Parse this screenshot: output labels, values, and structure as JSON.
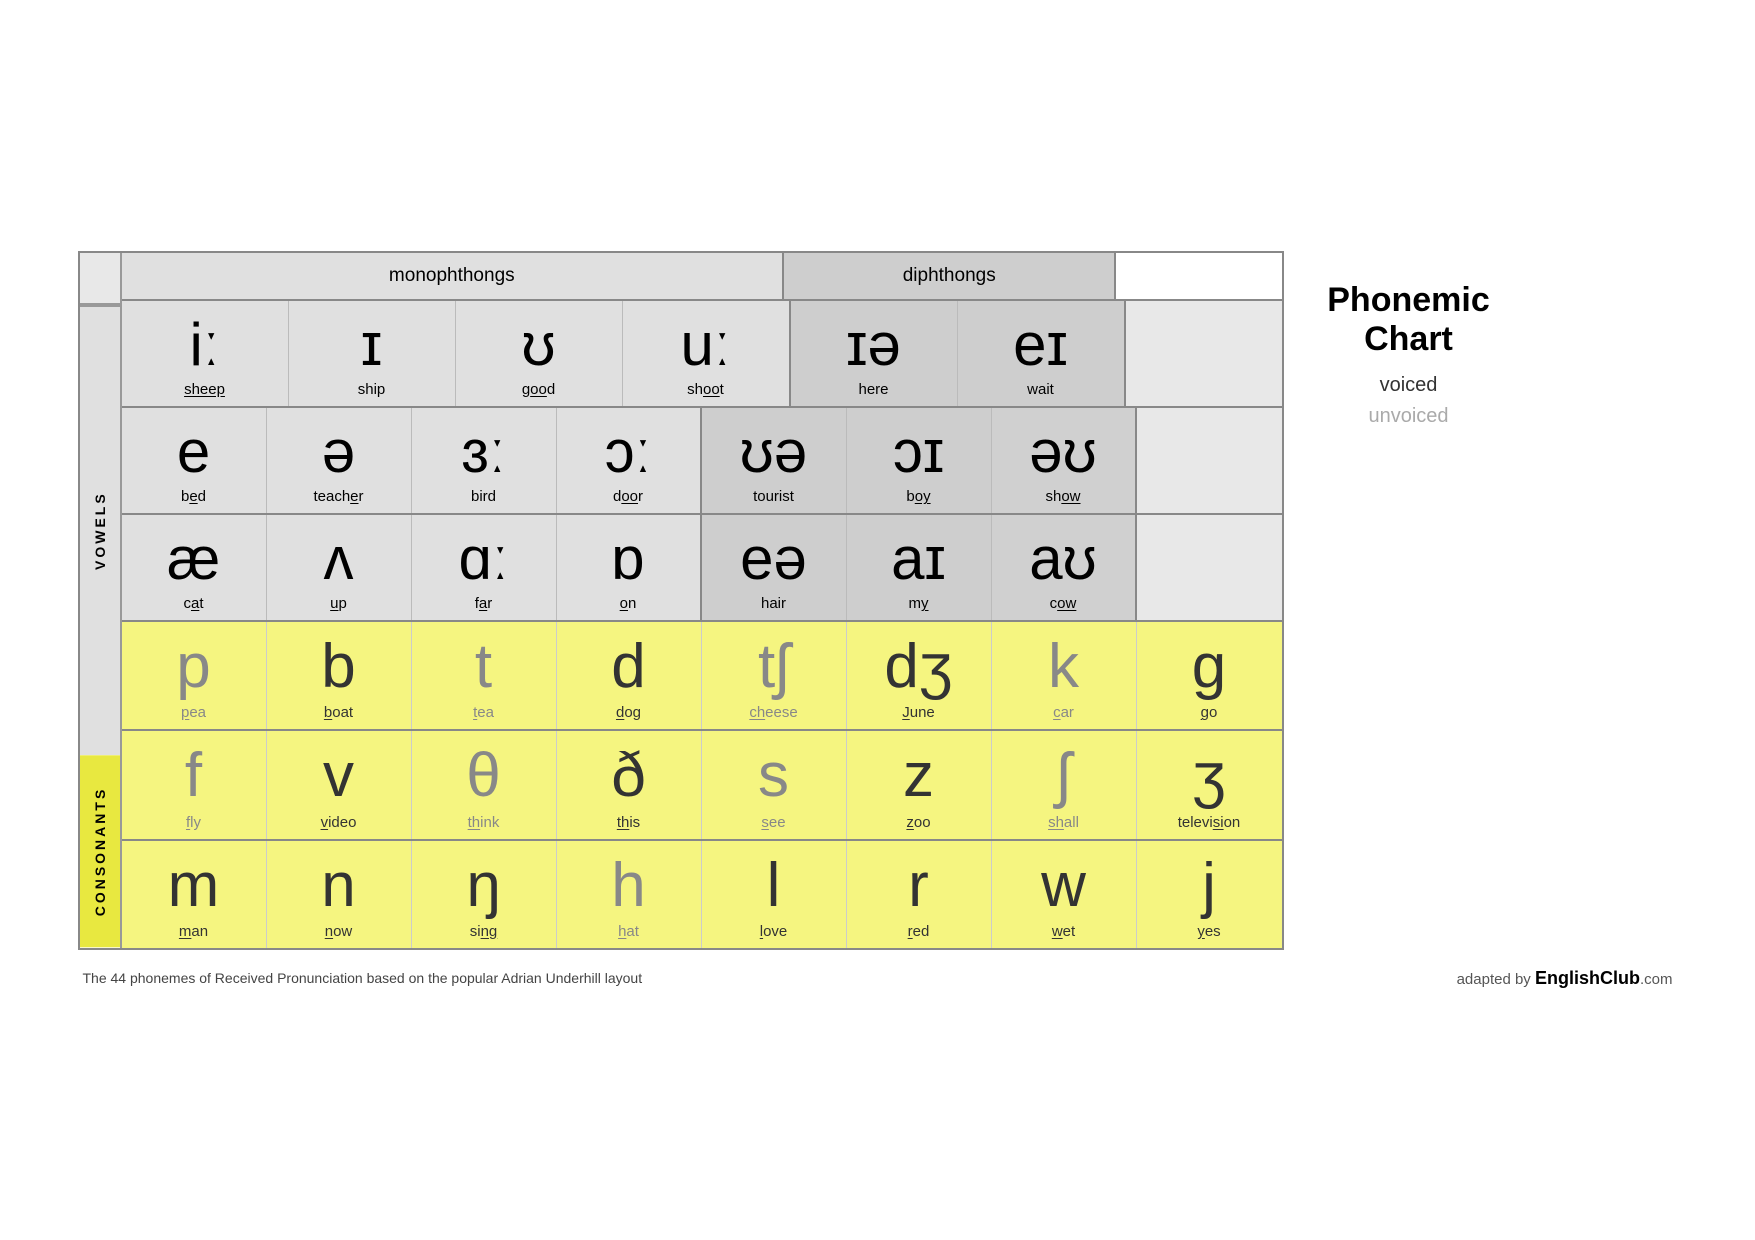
{
  "title": "Phonemic Chart",
  "legend": {
    "title": "Phonemic\nChart",
    "voiced_label": "voiced",
    "unvoiced_label": "unvoiced"
  },
  "header": {
    "monophthongs": "monophthongs",
    "diphthongs": "diphthongs"
  },
  "labels": {
    "vowels": "VOWELS",
    "consonants": "CONSONANTS"
  },
  "vowel_rows": [
    {
      "cells": [
        {
          "phoneme": "iː",
          "word": "sheep",
          "underline_chars": []
        },
        {
          "phoneme": "ɪ",
          "word": "ship",
          "underline_chars": []
        },
        {
          "phoneme": "ʊ",
          "word": "good",
          "underline_chars": [
            "oo"
          ]
        },
        {
          "phoneme": "uː",
          "word": "shoot",
          "underline_chars": [
            "oo"
          ]
        }
      ],
      "diphthong_cells": [
        {
          "phoneme": "ɪə",
          "word": "here",
          "underline_chars": []
        },
        {
          "phoneme": "eɪ",
          "word": "wait",
          "underline_chars": []
        }
      ],
      "extra_cells": []
    },
    {
      "cells": [
        {
          "phoneme": "e",
          "word": "bed",
          "underline_chars": [
            "e"
          ]
        },
        {
          "phoneme": "ə",
          "word": "teacher",
          "underline_chars": [
            "e"
          ]
        },
        {
          "phoneme": "ɜː",
          "word": "bird",
          "underline_chars": []
        },
        {
          "phoneme": "ɔː",
          "word": "door",
          "underline_chars": [
            "oo"
          ]
        }
      ],
      "diphthong_cells": [
        {
          "phoneme": "ʊə",
          "word": "tourist",
          "underline_chars": []
        },
        {
          "phoneme": "ɔɪ",
          "word": "boy",
          "underline_chars": [
            "oy"
          ]
        },
        {
          "phoneme": "əʊ",
          "word": "show",
          "underline_chars": [
            "ow"
          ]
        }
      ],
      "extra_cells": []
    },
    {
      "cells": [
        {
          "phoneme": "æ",
          "word": "cat",
          "underline_chars": [
            "a"
          ]
        },
        {
          "phoneme": "ʌ",
          "word": "up",
          "underline_chars": [
            "u"
          ]
        },
        {
          "phoneme": "ɑː",
          "word": "far",
          "underline_chars": [
            "a"
          ]
        },
        {
          "phoneme": "ɒ",
          "word": "on",
          "underline_chars": [
            "o"
          ]
        }
      ],
      "diphthong_cells": [
        {
          "phoneme": "eə",
          "word": "hair",
          "underline_chars": []
        },
        {
          "phoneme": "aɪ",
          "word": "my",
          "underline_chars": [
            "y"
          ]
        },
        {
          "phoneme": "aʊ",
          "word": "cow",
          "underline_chars": [
            "ow"
          ]
        }
      ],
      "extra_cells": []
    }
  ],
  "consonant_rows": [
    {
      "cells": [
        {
          "phoneme": "p",
          "word": "pea",
          "type": "unvoiced",
          "underline": "p"
        },
        {
          "phoneme": "b",
          "word": "boat",
          "type": "voiced",
          "underline": "b"
        },
        {
          "phoneme": "t",
          "word": "tea",
          "type": "unvoiced",
          "underline": "t"
        },
        {
          "phoneme": "d",
          "word": "dog",
          "type": "voiced",
          "underline": "d"
        },
        {
          "phoneme": "tʃ",
          "word": "cheese",
          "type": "unvoiced",
          "underline": "ch"
        },
        {
          "phoneme": "dʒ",
          "word": "June",
          "type": "voiced",
          "underline": "J"
        },
        {
          "phoneme": "k",
          "word": "car",
          "type": "unvoiced",
          "underline": "c"
        },
        {
          "phoneme": "g",
          "word": "go",
          "type": "voiced",
          "underline": "g"
        }
      ]
    },
    {
      "cells": [
        {
          "phoneme": "f",
          "word": "fly",
          "type": "unvoiced",
          "underline": "f"
        },
        {
          "phoneme": "v",
          "word": "video",
          "type": "voiced",
          "underline": "v"
        },
        {
          "phoneme": "θ",
          "word": "think",
          "type": "unvoiced",
          "underline": "th"
        },
        {
          "phoneme": "ð",
          "word": "this",
          "type": "voiced",
          "underline": "th"
        },
        {
          "phoneme": "s",
          "word": "see",
          "type": "unvoiced",
          "underline": "s"
        },
        {
          "phoneme": "z",
          "word": "zoo",
          "type": "voiced",
          "underline": "z"
        },
        {
          "phoneme": "ʃ",
          "word": "shall",
          "type": "unvoiced",
          "underline": "sh"
        },
        {
          "phoneme": "ʒ",
          "word": "television",
          "type": "voiced",
          "underline": "si"
        }
      ]
    },
    {
      "cells": [
        {
          "phoneme": "m",
          "word": "man",
          "type": "voiced",
          "underline": "m"
        },
        {
          "phoneme": "n",
          "word": "now",
          "type": "voiced",
          "underline": "n"
        },
        {
          "phoneme": "ŋ",
          "word": "sing",
          "type": "voiced",
          "underline": "ng"
        },
        {
          "phoneme": "h",
          "word": "hat",
          "type": "unvoiced",
          "underline": "h"
        },
        {
          "phoneme": "l",
          "word": "love",
          "type": "voiced",
          "underline": "l"
        },
        {
          "phoneme": "r",
          "word": "red",
          "type": "voiced",
          "underline": "r"
        },
        {
          "phoneme": "w",
          "word": "wet",
          "type": "voiced",
          "underline": "w"
        },
        {
          "phoneme": "j",
          "word": "yes",
          "type": "voiced",
          "underline": "y"
        }
      ]
    }
  ],
  "footer": {
    "note": "The 44 phonemes of Received Pronunciation based on the popular Adrian Underhill layout",
    "adapted_by": "adapted by ",
    "brand": "EnglishClub",
    "brand_suffix": ".com"
  }
}
